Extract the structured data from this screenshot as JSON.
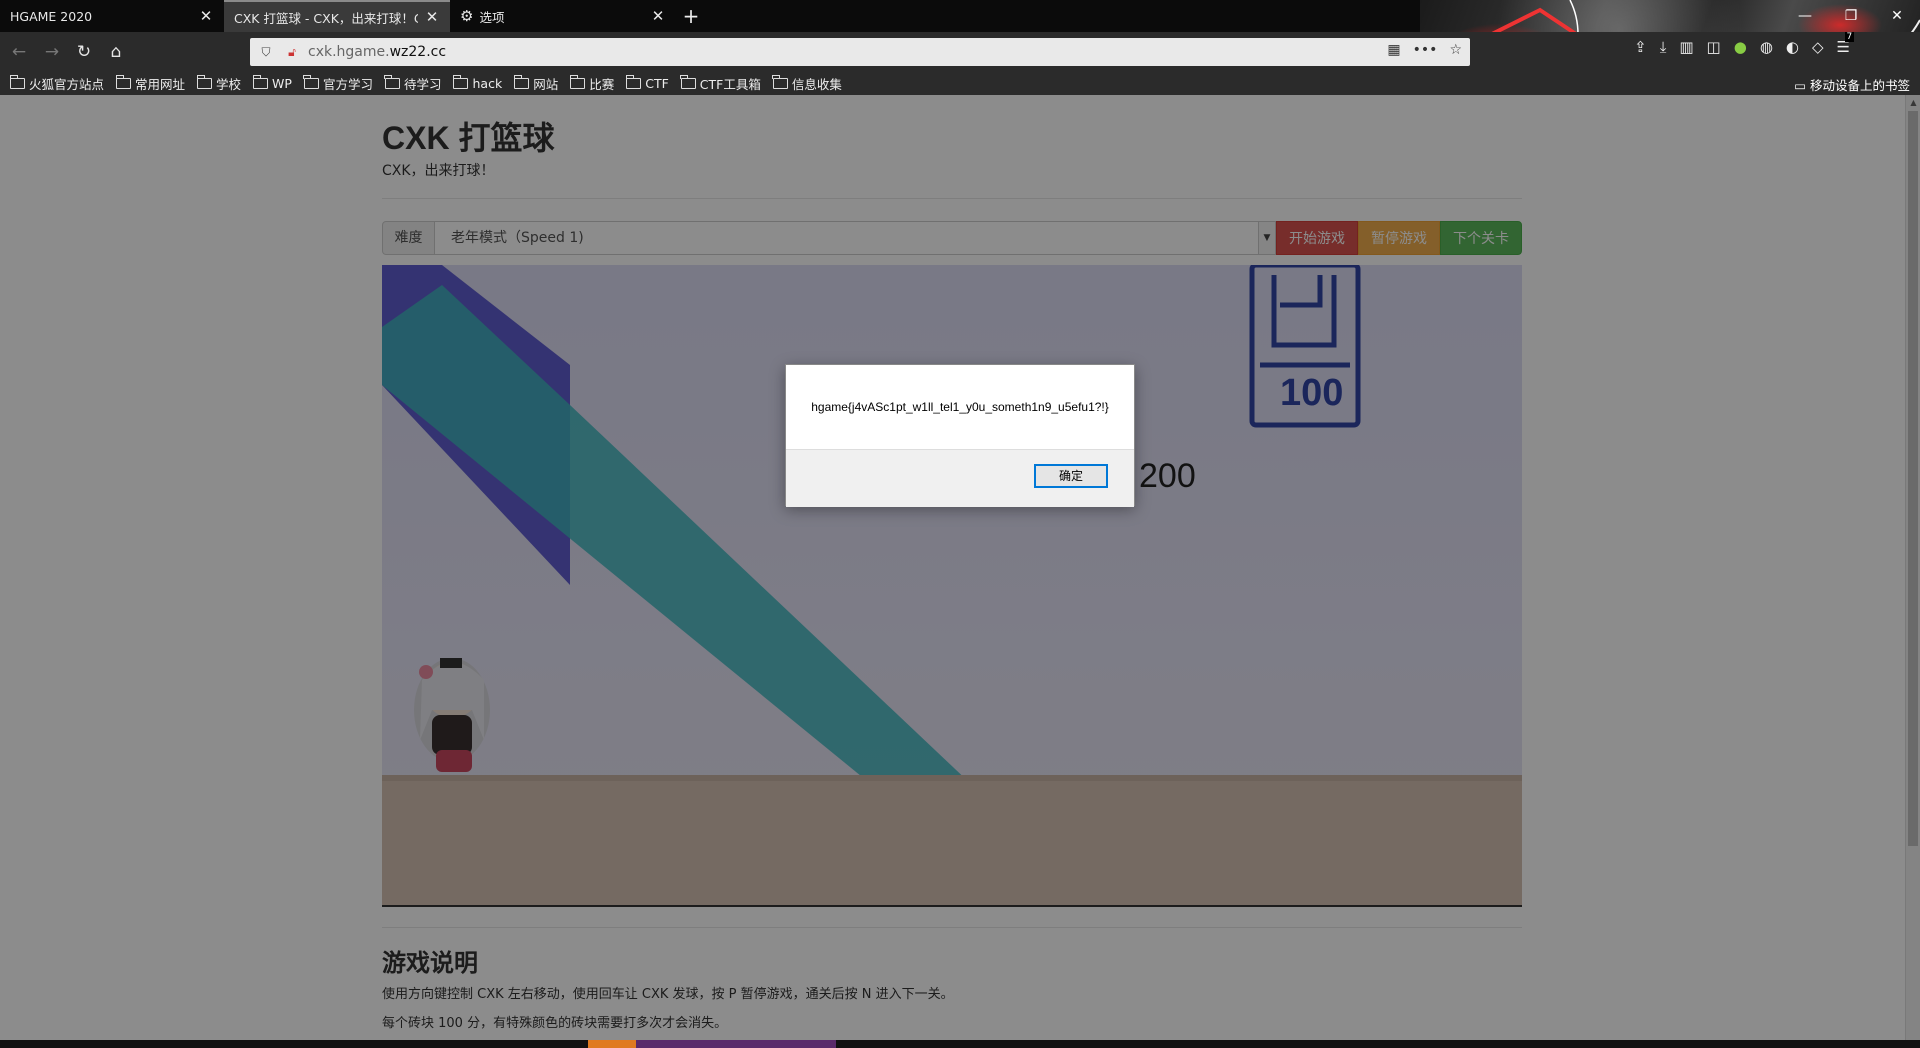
{
  "tabs": [
    {
      "label": "HGAME 2020",
      "close": "✕"
    },
    {
      "label": "CXK 打篮球 - CXK，出来打球！CXK",
      "close": "✕"
    },
    {
      "label": "选项",
      "close": "✕"
    }
  ],
  "newtab": "+",
  "url": {
    "prefix": "cxk.hgame.",
    "domain": "wz22.cc"
  },
  "bookmarks": [
    "火狐官方站点",
    "常用网址",
    "学校",
    "WP",
    "官方学习",
    "待学习",
    "hack",
    "网站",
    "比赛",
    "CTF",
    "CTF工具箱",
    "信息收集"
  ],
  "mobile_bookmarks": "移动设备上的书签",
  "toolbar_badge": "7",
  "page": {
    "title": "CXK 打篮球",
    "subtitle": "CXK，出来打球！",
    "difficulty_label": "难度",
    "difficulty_value": "老年模式（Speed 1)",
    "btn_start": "开始游戏",
    "btn_pause": "暂停游戏",
    "btn_next": "下个关卡",
    "score": "200",
    "help_title": "游戏说明",
    "help_lines": [
      "使用方向键控制 CXK 左右移动，使用回车让 CXK 发球，按 P 暂停游戏，通关后按 N 进入下一关。",
      "每个砖块 100 分，有特殊颜色的砖块需要打多次才会消失。"
    ]
  },
  "dialog": {
    "message": "hgame{j4vASc1pt_w1ll_tel1_y0u_someth1n9_u5efu1?!}",
    "ok": "确定"
  },
  "colors": {
    "danger": "#d9534f",
    "warning": "#f0ad4e",
    "success": "#5cb85c"
  }
}
